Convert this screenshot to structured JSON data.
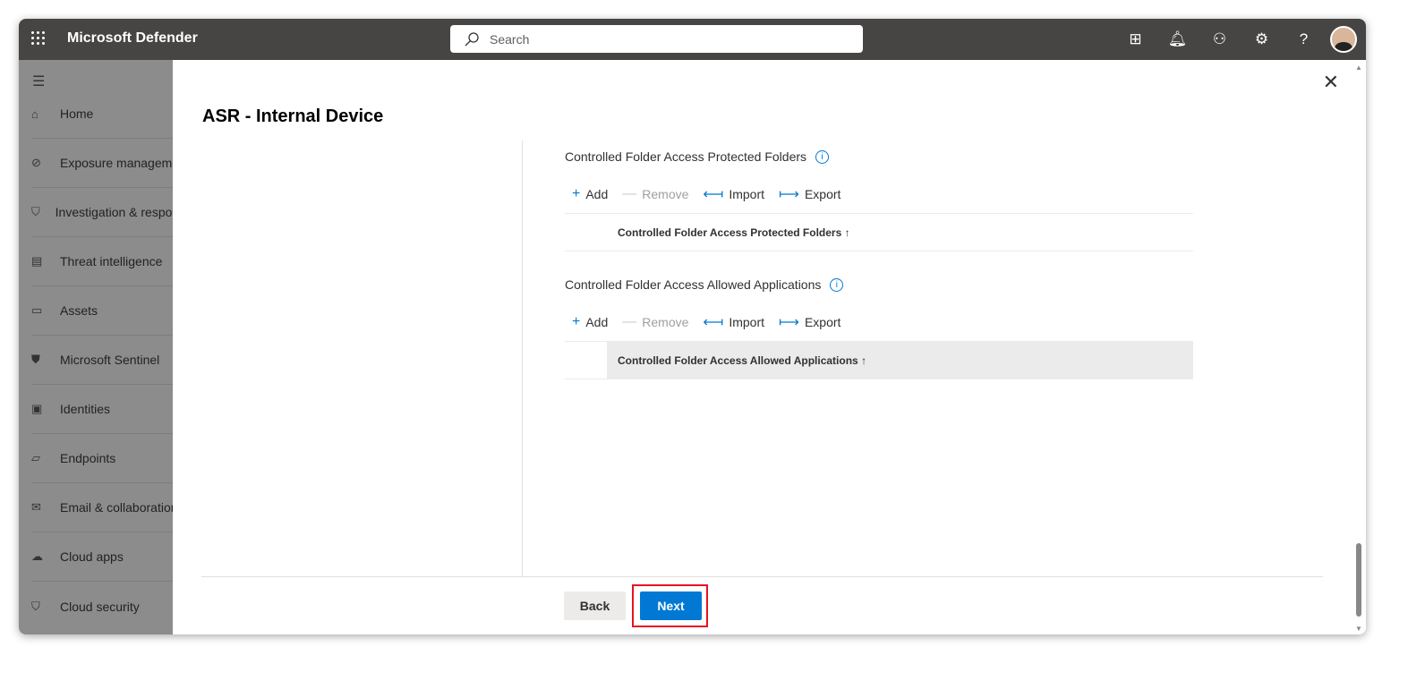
{
  "app": {
    "title": "Microsoft Defender",
    "search_placeholder": "Search"
  },
  "topbar_icons": [
    "org-chart-icon",
    "bell-icon",
    "community-icon",
    "gear-icon",
    "help-icon"
  ],
  "help_glyph": "?",
  "sidebar": {
    "items": [
      {
        "label": "Home",
        "icon": "home-icon"
      },
      {
        "label": "Exposure management",
        "icon": "compass-icon"
      },
      {
        "label": "Investigation & response",
        "icon": "shield-alert-icon"
      },
      {
        "label": "Threat intelligence",
        "icon": "threat-intel-icon"
      },
      {
        "label": "Assets",
        "icon": "assets-icon"
      },
      {
        "label": "Microsoft Sentinel",
        "icon": "sentinel-icon"
      },
      {
        "label": "Identities",
        "icon": "identity-icon"
      },
      {
        "label": "Endpoints",
        "icon": "endpoints-icon"
      },
      {
        "label": "Email & collaboration",
        "icon": "mail-icon"
      },
      {
        "label": "Cloud apps",
        "icon": "cloud-icon"
      },
      {
        "label": "Cloud security",
        "icon": "cloud-security-icon"
      }
    ]
  },
  "panel": {
    "title": "ASR - Internal Device",
    "sections": [
      {
        "title": "Controlled Folder Access Protected Folders",
        "add": "Add",
        "remove": "Remove",
        "import": "Import",
        "export": "Export",
        "column": "Controlled Folder Access Protected Folders",
        "sort": "↑"
      },
      {
        "title": "Controlled Folder Access Allowed Applications",
        "add": "Add",
        "remove": "Remove",
        "import": "Import",
        "export": "Export",
        "column": "Controlled Folder Access Allowed Applications",
        "sort": "↑"
      }
    ],
    "back": "Back",
    "next": "Next"
  },
  "colors": {
    "accent": "#0078d4",
    "topbar": "#474543",
    "highlight": "#e81123"
  }
}
